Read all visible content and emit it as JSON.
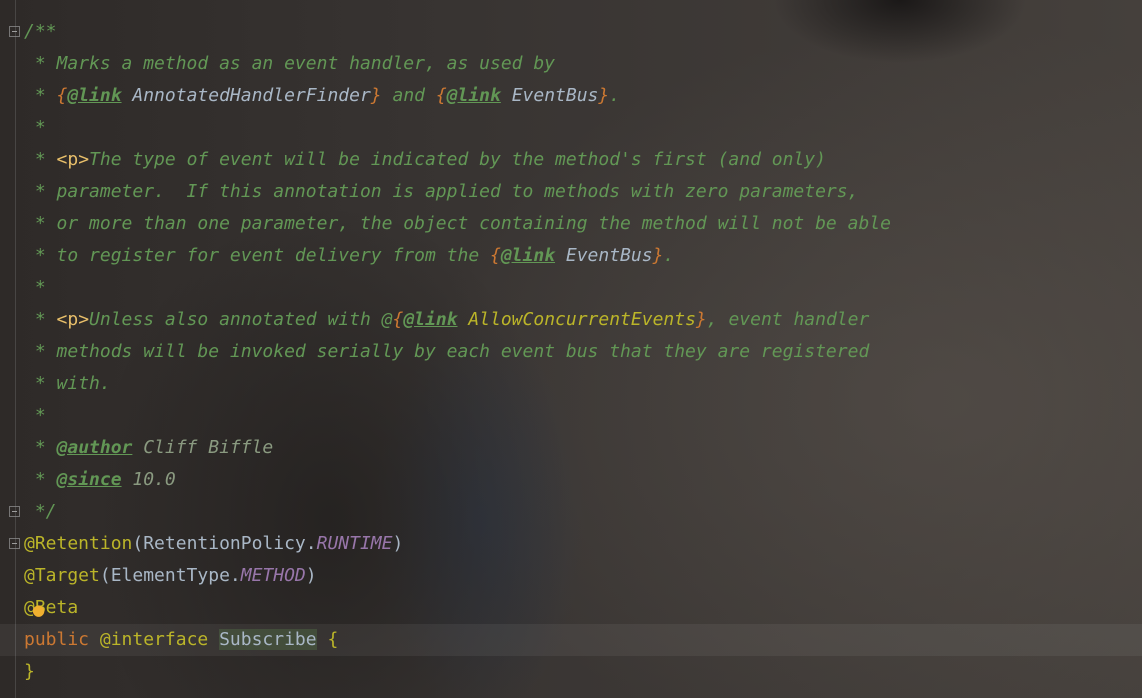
{
  "editor": {
    "lines": [
      "/**",
      " * Marks a method as an event handler, as used by",
      " * {@link AnnotatedHandlerFinder} and {@link EventBus}.",
      " *",
      " * <p>The type of event will be indicated by the method's first (and only)",
      " * parameter.  If this annotation is applied to methods with zero parameters,",
      " * or more than one parameter, the object containing the method will not be able",
      " * to register for event delivery from the {@link EventBus}.",
      " *",
      " * <p>Unless also annotated with @{@link AllowConcurrentEvents}, event handler",
      " * methods will be invoked serially by each event bus that they are registered",
      " * with.",
      " *",
      " * @author Cliff Biffle",
      " * @since 10.0",
      " */",
      "@Retention(RetentionPolicy.RUNTIME)",
      "@Target(ElementType.METHOD)",
      "@Beta",
      "public @interface Subscribe {",
      "}"
    ],
    "tokens": {
      "comment_open": "/**",
      "star": " * ",
      "star_only": " *",
      "comment_close": " */",
      "l1_text": "Marks a method as an event handler, as used by",
      "l2_open1": "{",
      "l2_tag1": "@link",
      "l2_ref1": " AnnotatedHandlerFinder",
      "l2_close1": "}",
      "l2_and": " and ",
      "l2_open2": "{",
      "l2_tag2": "@link",
      "l2_ref2": " EventBus",
      "l2_close2": "}",
      "l2_dot": ".",
      "l4_p": "<p>",
      "l4_text": "The type of event will be indicated by the method's first (and only)",
      "l5_text": "parameter.  If this annotation is applied to methods with zero parameters,",
      "l6_text": "or more than one parameter, the object containing the method will not be able",
      "l7_text": "to register for event delivery from the ",
      "l7_open": "{",
      "l7_tag": "@link",
      "l7_ref": " EventBus",
      "l7_close": "}",
      "l7_dot": ".",
      "l9_p": "<p>",
      "l9_text1": "Unless also annotated with @",
      "l9_open": "{",
      "l9_tag": "@link",
      "l9_ref": " AllowConcurrentEvents",
      "l9_close": "}",
      "l9_text2": ", event handler",
      "l10_text": "methods will be invoked serially by each event bus that they are registered",
      "l11_text": "with.",
      "l13_tag": "@author",
      "l13_val": " Cliff Biffle",
      "l14_tag": "@since",
      "l14_val": " 10.0",
      "retention_anno": "@Retention",
      "retention_paren_open": "(",
      "retention_class": "RetentionPolicy.",
      "retention_const": "RUNTIME",
      "retention_paren_close": ")",
      "target_anno": "@Target",
      "target_paren_open": "(",
      "target_class": "ElementType.",
      "target_const": "METHOD",
      "target_paren_close": ")",
      "beta_anno": "@Beta",
      "kw_public": "public",
      "kw_interface": " @interface ",
      "class_name": "Subscribe",
      "brace_open": " {",
      "brace_close": "}"
    }
  },
  "icons": {
    "fold_marker": "fold-marker-icon",
    "intention_bulb": "lightbulb-icon",
    "bulb_glyph": "●"
  }
}
